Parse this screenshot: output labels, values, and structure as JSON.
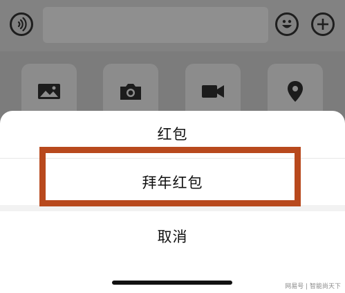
{
  "input_bar": {
    "icons": [
      "voice-icon",
      "emoji-icon",
      "plus-icon"
    ]
  },
  "panel": {
    "tiles": [
      {
        "icon": "image-icon"
      },
      {
        "icon": "camera-icon"
      },
      {
        "icon": "video-icon"
      },
      {
        "icon": "location-icon"
      }
    ]
  },
  "sheet": {
    "option_1": "红包",
    "option_2": "拜年红包",
    "cancel": "取消"
  },
  "highlight_color": "#b8491d",
  "watermark": "网易号 | 智能尚天下"
}
